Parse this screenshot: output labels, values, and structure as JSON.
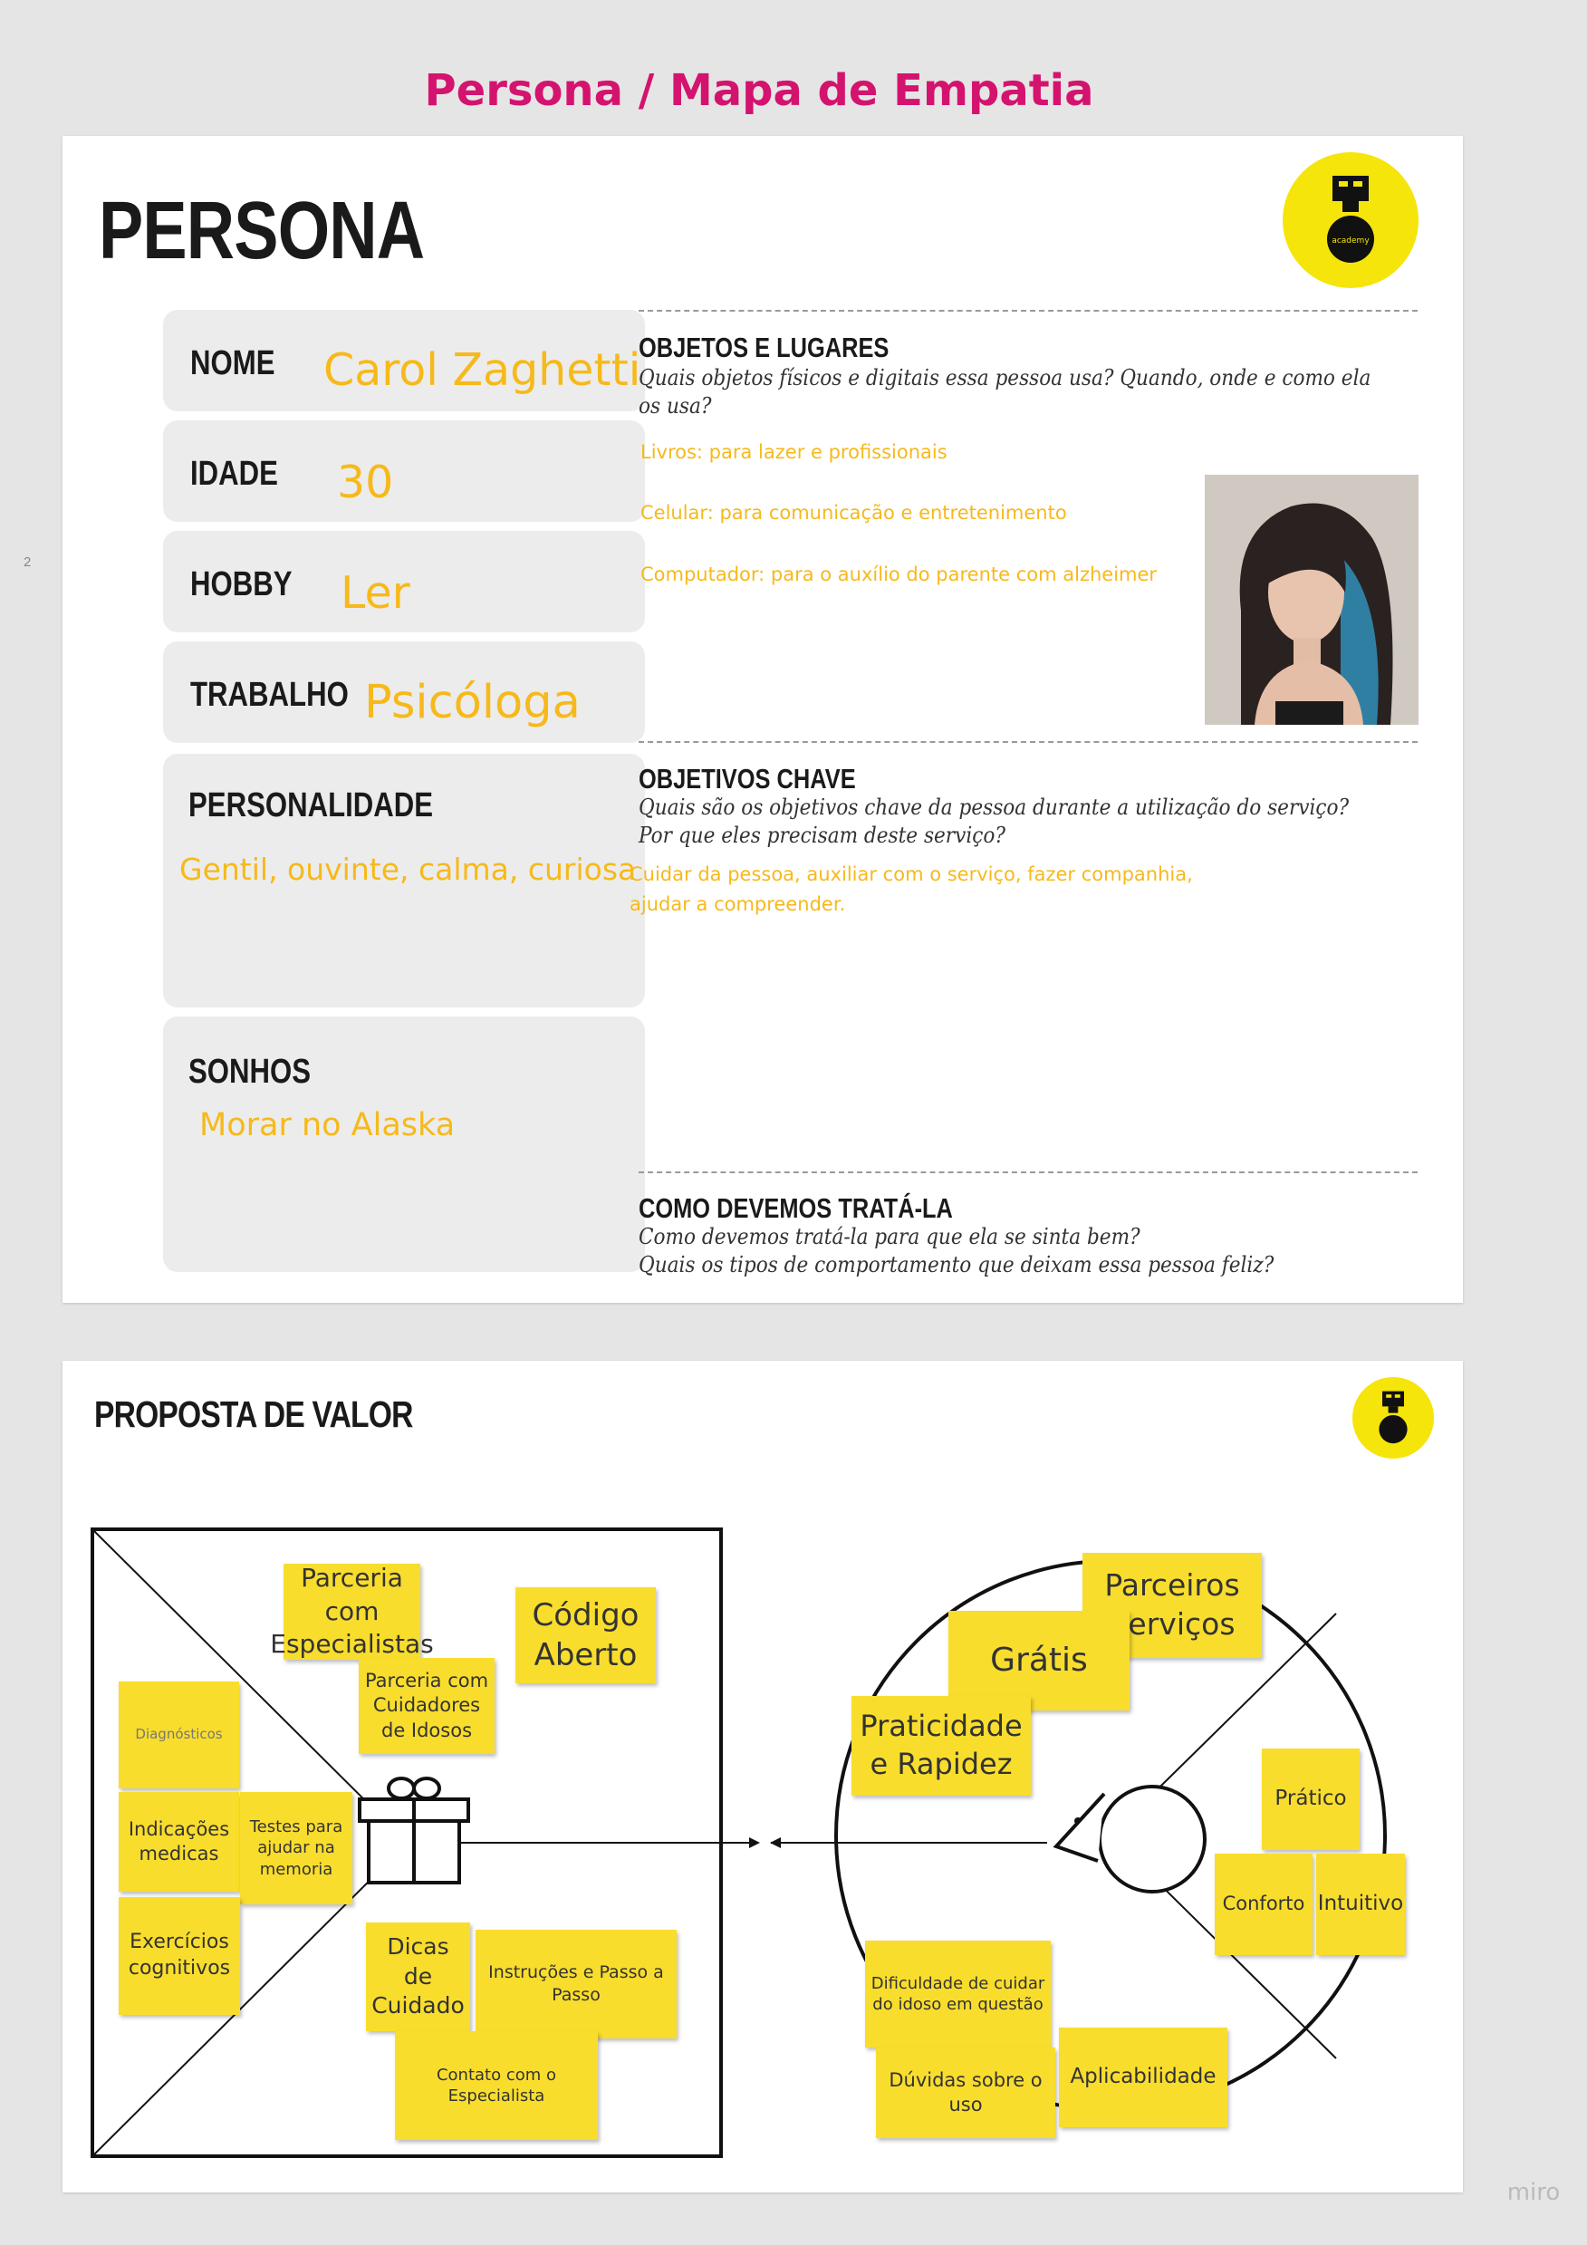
{
  "title": "Persona / Mapa de Empatia",
  "page_number": "2",
  "persona": {
    "heading": "PERSONA",
    "fields": {
      "name_label": "NOME",
      "name_value": "Carol Zaghetti",
      "age_label": "IDADE",
      "age_value": "30",
      "hobby_label": "HOBBY",
      "hobby_value": "Ler",
      "work_label": "TRABALHO",
      "work_value": "Psicóloga",
      "personality_label": "PERSONALIDADE",
      "personality_value": "Gentil, ouvinte, calma, curiosa",
      "dreams_label": "SONHOS",
      "dreams_value": "Morar no Alaska"
    },
    "sections": {
      "objects_title": "OBJETOS E LUGARES",
      "objects_question": "Quais objetos físicos e digitais essa pessoa usa? Quando, onde e como ela os usa?",
      "objects_items": [
        "Livros: para lazer e profissionais",
        "Celular: para comunicação e entretenimento",
        "Computador: para o auxílio do parente com alzheimer"
      ],
      "goals_title": "OBJETIVOS CHAVE",
      "goals_question_1": "Quais são os objetivos chave da pessoa durante a utilização do serviço?",
      "goals_question_2": "Por que eles precisam deste serviço?",
      "goals_answer_1": "Cuidar da pessoa, auxiliar com o serviço, fazer companhia,",
      "goals_answer_2": "ajudar a compreender.",
      "treat_title": "COMO DEVEMOS TRATÁ-LA",
      "treat_question_1": "Como devemos tratá-la para que ela se sinta bem?",
      "treat_question_2": "Quais os tipos de comportamento que deixam essa pessoa feliz?"
    }
  },
  "value_proposition": {
    "heading": "PROPOSTA DE VALOR",
    "left_stickies": [
      "Parceria com Especialistas",
      "Código Aberto",
      "Parceria com Cuidadores de Idosos",
      "Diagnósticos",
      "Indicações medicas",
      "Testes para ajudar na memoria",
      "Exercícios cognitivos",
      "Dicas de Cuidado",
      "Instruções e Passo a Passo",
      "Contato com o Especialista"
    ],
    "right_stickies": [
      "Parceiros Serviços",
      "Grátis",
      "Praticidade e Rapidez",
      "Prático",
      "Conforto",
      "Intuitivo",
      "Dificuldade de cuidar do idoso em questão",
      "Dúvidas sobre o uso",
      "Aplicabilidade"
    ]
  },
  "branding": {
    "logo_text": "academy",
    "watermark": "miro"
  },
  "colors": {
    "title": "#d4136e",
    "answer_text": "#f7b91a",
    "sticky": "#f9dd2d",
    "logo": "#f5e50a"
  }
}
